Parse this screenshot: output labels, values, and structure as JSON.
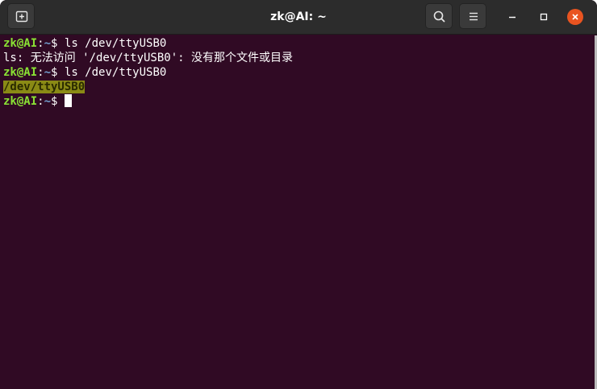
{
  "window": {
    "title": "zk@AI: ~",
    "icons": {
      "new_tab": "new-tab-icon",
      "search": "search-icon",
      "menu": "hamburger-menu-icon",
      "minimize": "minimize-icon",
      "maximize": "maximize-icon",
      "close": "close-icon"
    },
    "colors": {
      "terminal_bg": "#300a24",
      "titlebar_bg": "#2c2c2c",
      "prompt_user": "#8ae234",
      "prompt_path": "#729fcf",
      "close_button": "#e95420"
    }
  },
  "terminal": {
    "lines": [
      {
        "user": "zk@AI",
        "sep": ":",
        "path": "~",
        "sign": "$",
        "cmd": " ls /dev/ttyUSB0"
      },
      {
        "output": "ls: 无法访问 '/dev/ttyUSB0': 没有那个文件或目录"
      },
      {
        "user": "zk@AI",
        "sep": ":",
        "path": "~",
        "sign": "$",
        "cmd": " ls /dev/ttyUSB0"
      },
      {
        "output": "/dev/ttyUSB0"
      },
      {
        "user": "zk@AI",
        "sep": ":",
        "path": "~",
        "sign": "$",
        "cmd": " "
      }
    ]
  }
}
